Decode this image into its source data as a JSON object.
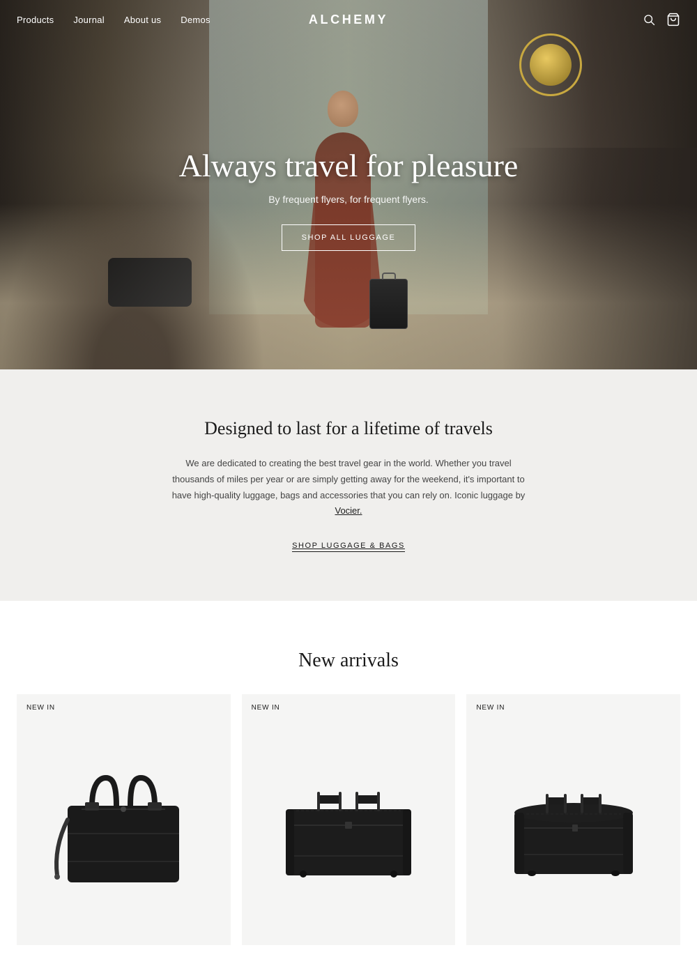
{
  "nav": {
    "logo": "ALCHEMY",
    "items": [
      {
        "label": "Products",
        "id": "products"
      },
      {
        "label": "Journal",
        "id": "journal"
      },
      {
        "label": "About us",
        "id": "about-us"
      },
      {
        "label": "Demos",
        "id": "demos"
      }
    ],
    "search_icon": "search",
    "cart_icon": "shopping-bag"
  },
  "hero": {
    "title": "Always travel for pleasure",
    "subtitle": "By frequent flyers, for frequent flyers.",
    "cta_label": "SHOP ALL LUGGAGE"
  },
  "about_section": {
    "heading": "Designed to last for a lifetime of travels",
    "body": "We are dedicated to creating the best travel gear in the world. Whether you travel thousands of miles per year or are simply getting away for the weekend, it's important to have high-quality luggage, bags and accessories that you can rely on. Iconic luggage by Vocier.",
    "vocier_link_text": "Vocier.",
    "shop_link": "SHOP LUGGAGE & BAGS"
  },
  "arrivals_section": {
    "heading": "New arrivals",
    "badge": "NEW IN",
    "products": [
      {
        "id": 1,
        "badge": "NEW IN",
        "alt": "Black leather tote bag with shoulder strap"
      },
      {
        "id": 2,
        "badge": "NEW IN",
        "alt": "Black leather large duffle bag"
      },
      {
        "id": 3,
        "badge": "NEW IN",
        "alt": "Black leather medium duffle bag"
      }
    ]
  }
}
